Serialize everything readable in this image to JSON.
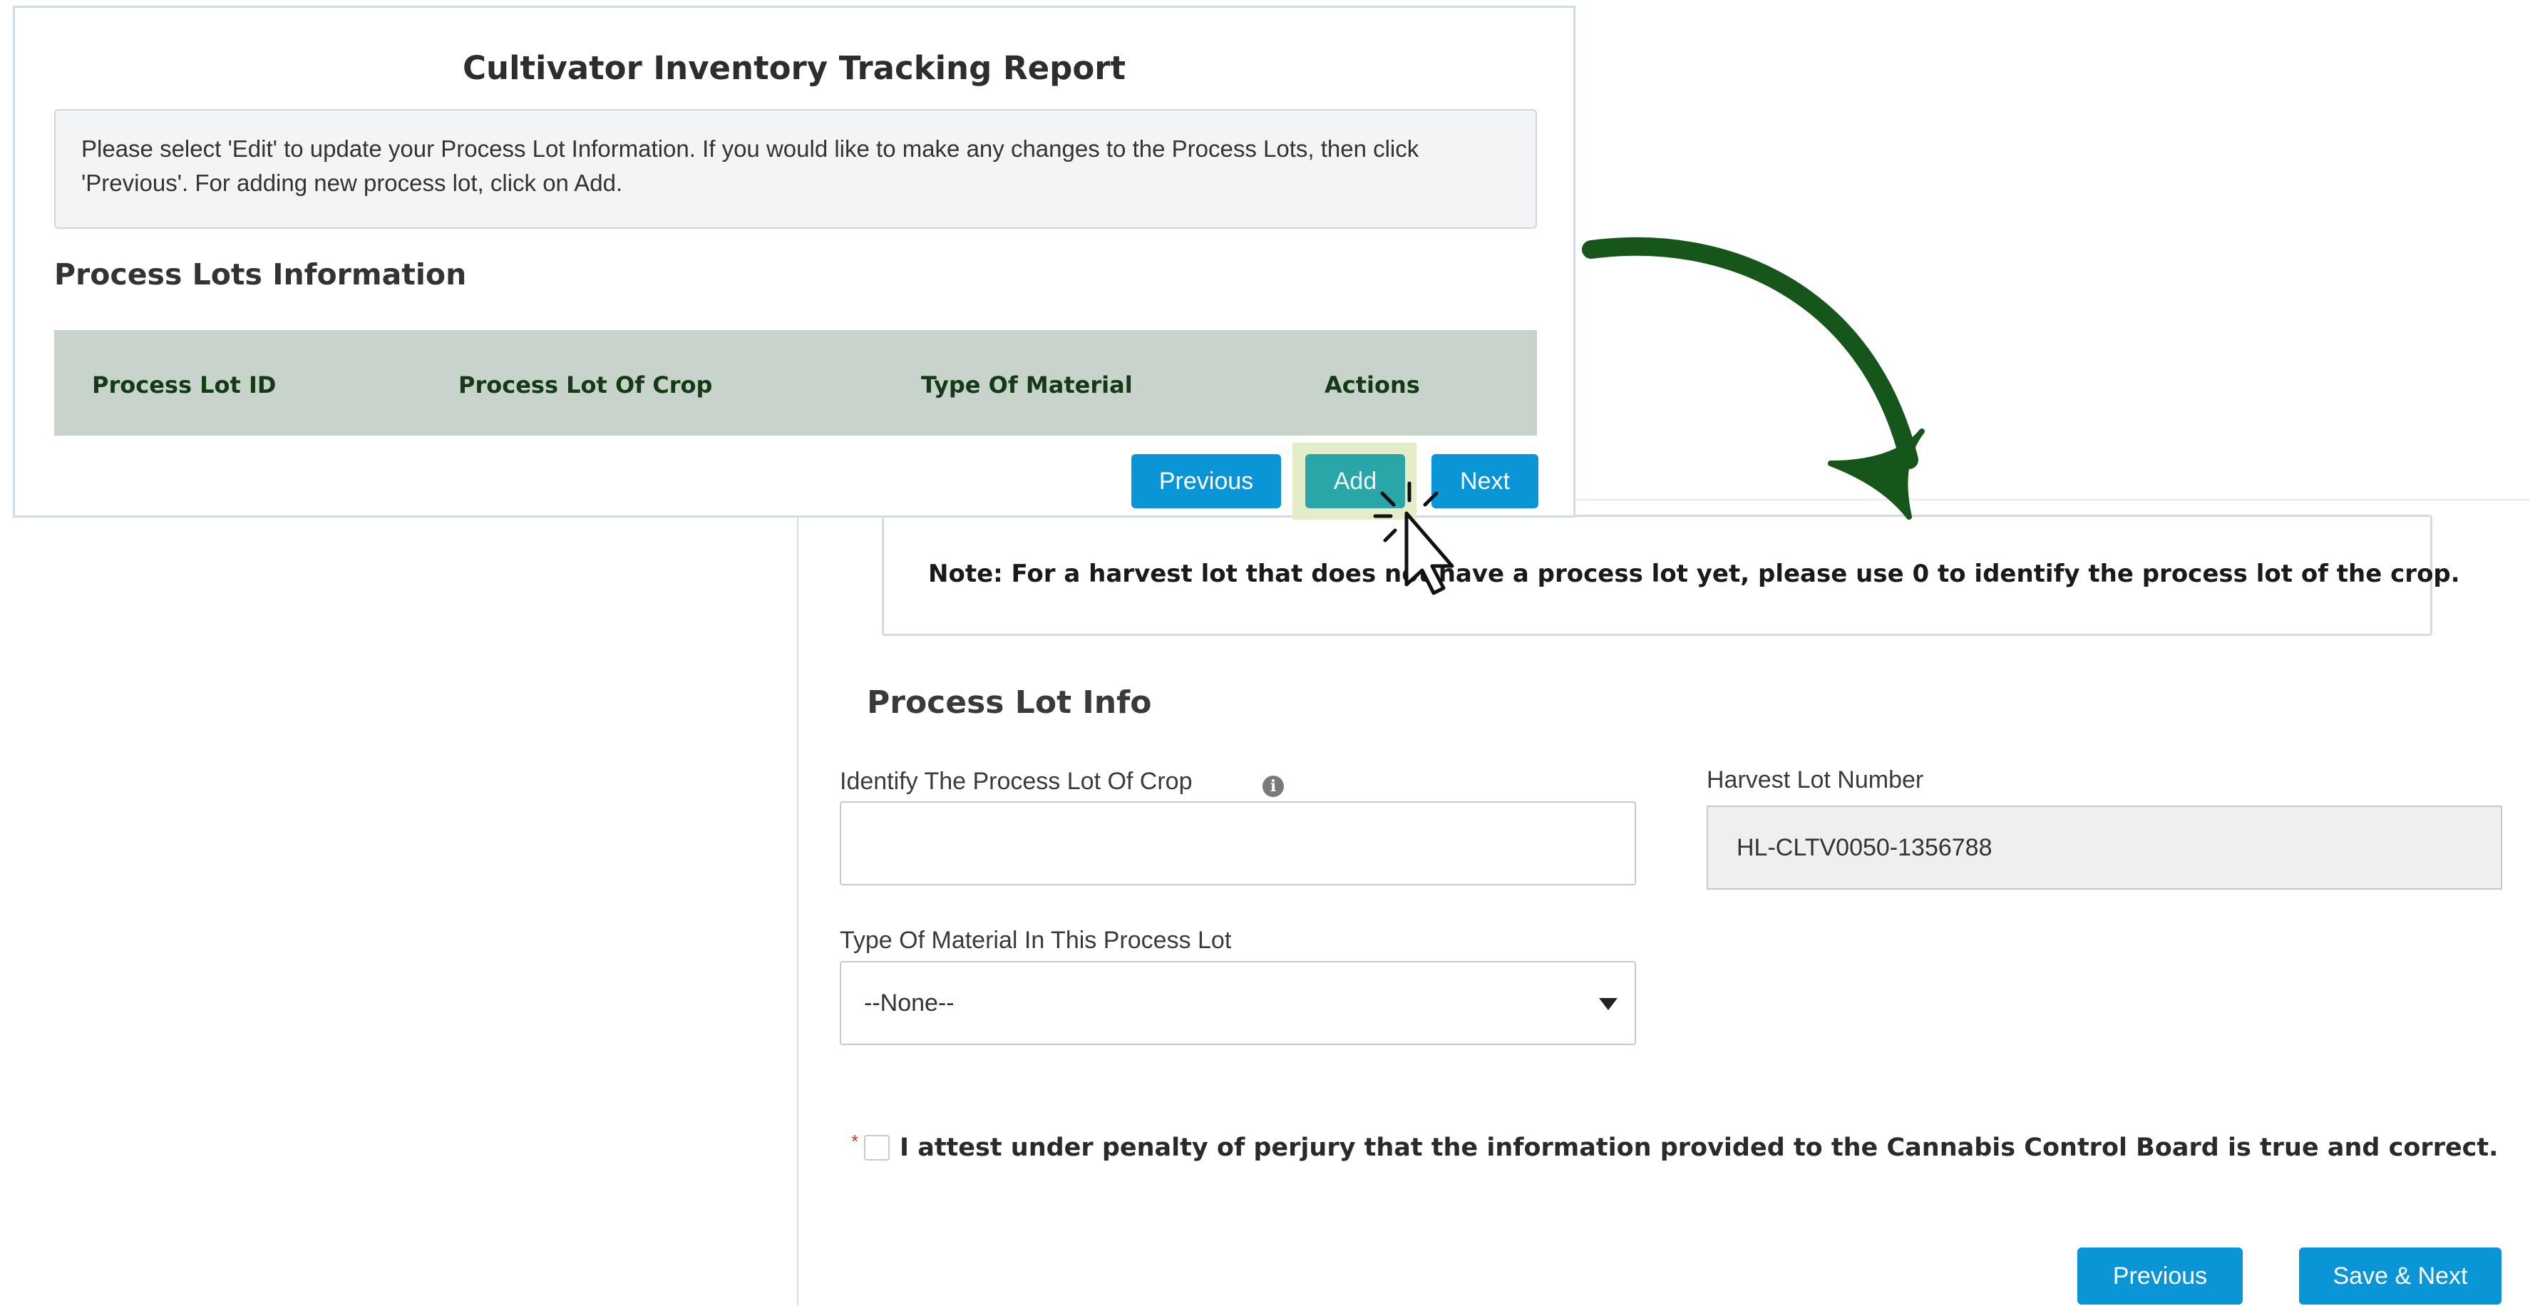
{
  "report": {
    "title": "Cultivator Inventory Tracking Report",
    "instructions": "Please select 'Edit' to update your Process Lot Information. If you would like to make any changes to the Process Lots, then click 'Previous'. For adding new process lot, click on Add.",
    "section_title": "Process Lots Information",
    "table_headers": [
      "Process Lot ID",
      "Process Lot Of Crop",
      "Type Of Material",
      "Actions"
    ],
    "buttons": {
      "previous": "Previous",
      "add": "Add",
      "next": "Next"
    }
  },
  "form": {
    "note": "Note: For a harvest lot that does not have a process lot yet, please use 0 to identify the process lot of the crop.",
    "section_title": "Process Lot Info",
    "crop_label": "Identify The Process Lot Of Crop",
    "crop_value": "",
    "harvest_label": "Harvest Lot Number",
    "harvest_value": "HL-CLTV0050-1356788",
    "material_label": "Type Of Material In This Process Lot",
    "material_value": "--None--",
    "required_marker": "*",
    "attest_text": "I attest under penalty of perjury that the information provided to the Cannabis Control Board is true and correct.",
    "buttons": {
      "previous": "Previous",
      "save_next": "Save & Next"
    }
  },
  "icons": {
    "info": "info-icon",
    "dropdown": "chevron-down-icon",
    "cursor": "mouse-cursor-icon",
    "arrow": "curved-arrow-icon"
  },
  "colors": {
    "primary_button": "#0a95d6",
    "add_button": "#2aa5a8",
    "add_highlight": "#e3eec8",
    "table_header_bg": "#c8d3cb",
    "table_header_text": "#143a16",
    "arrow": "#17561a",
    "required": "#d9342b"
  }
}
